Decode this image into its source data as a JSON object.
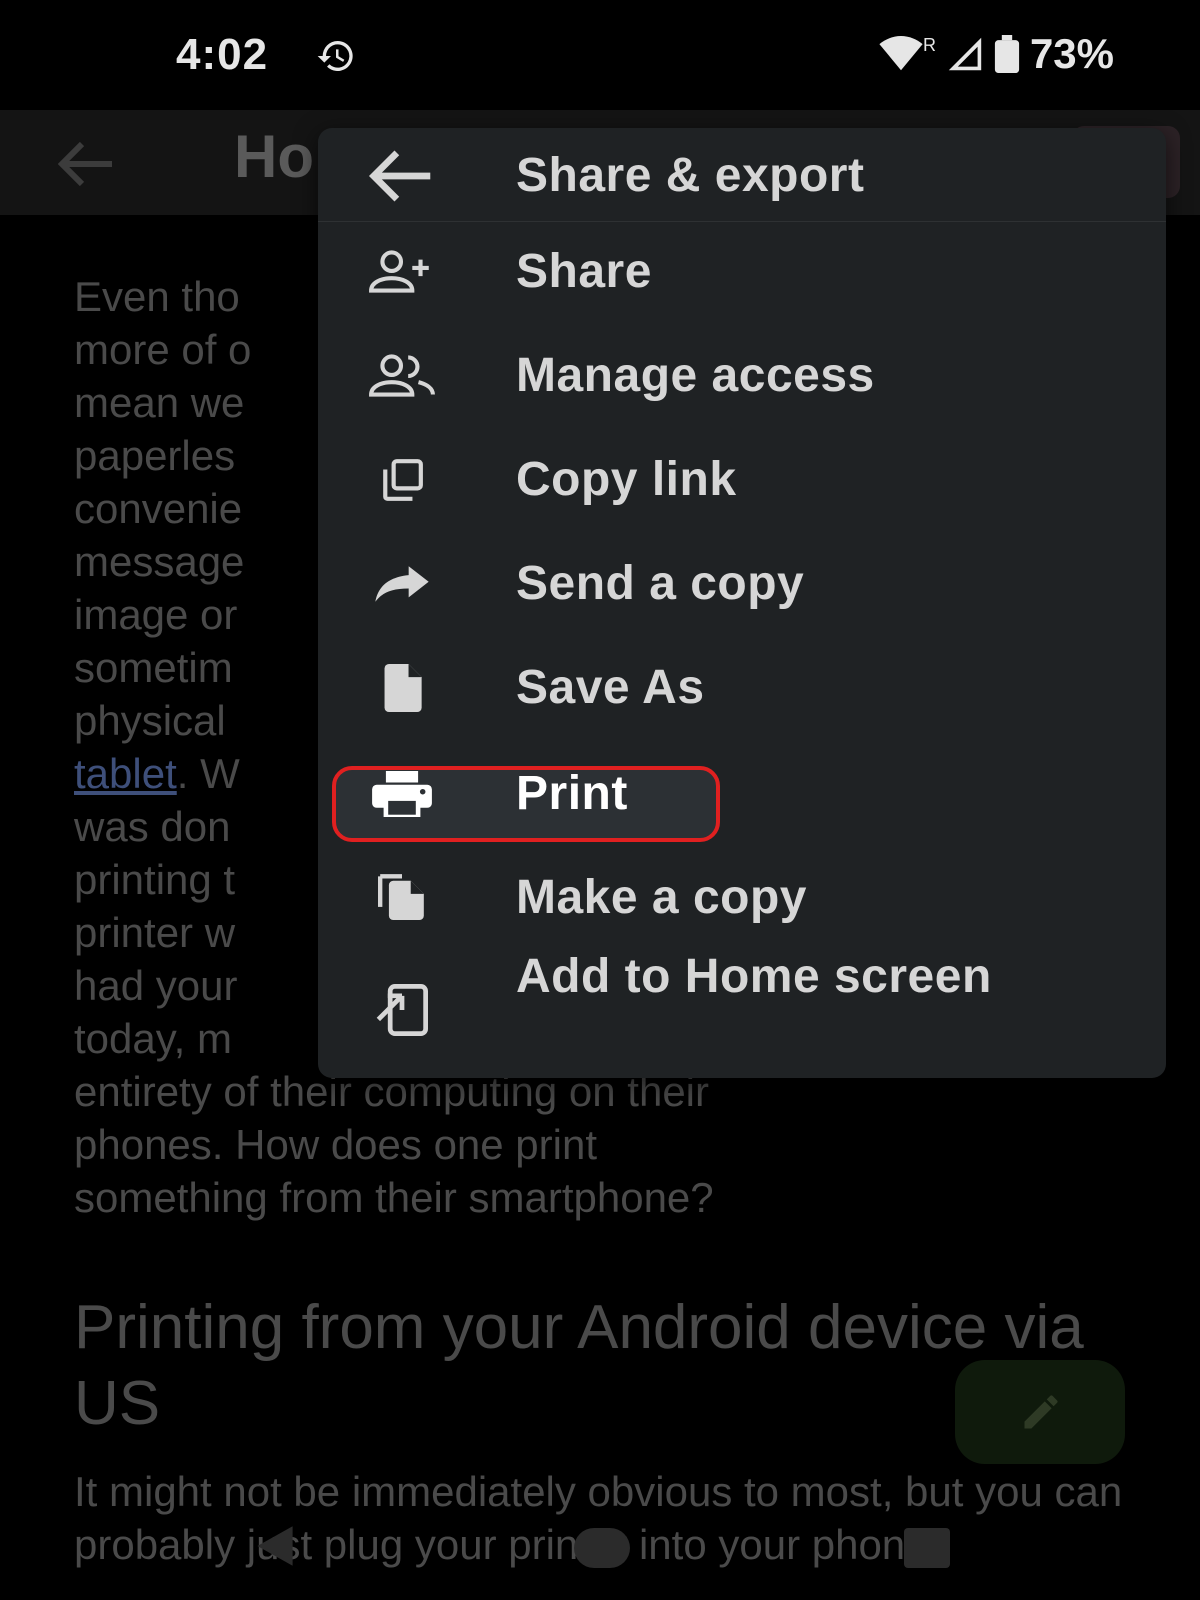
{
  "status_bar": {
    "time": "4:02",
    "battery": "73%",
    "network_badge": "R"
  },
  "app_bar": {
    "title_partial": "Ho"
  },
  "document": {
    "paragraph1": [
      {
        "text": "Even tho"
      },
      {
        "text": "more of o"
      },
      {
        "text": "mean we"
      },
      {
        "text": "paperles"
      },
      {
        "text": "convenie"
      },
      {
        "text": "message"
      },
      {
        "text": "image or"
      },
      {
        "text": "sometim"
      },
      {
        "text": "physical"
      },
      {
        "text": "tablet",
        "link": true,
        "suffix": ". W"
      },
      {
        "text": "was don"
      },
      {
        "text": "printing t"
      },
      {
        "text": "printer w"
      },
      {
        "text": "had your"
      },
      {
        "text": "today, m"
      },
      {
        "text": "entirety of their computing on their"
      },
      {
        "text": "phones. How does one print"
      },
      {
        "text": "something from their smartphone?"
      }
    ],
    "heading": "Printing from your Android device via US",
    "paragraph2": "It might not be immediately obvious to most, but you can probably just plug your printer into your phone"
  },
  "menu": {
    "header": "Share & export",
    "items": [
      {
        "id": "share",
        "label": "Share",
        "icon": "person-add-icon"
      },
      {
        "id": "manage",
        "label": "Manage access",
        "icon": "people-icon"
      },
      {
        "id": "copy-link",
        "label": "Copy link",
        "icon": "copy-icon"
      },
      {
        "id": "send-copy",
        "label": "Send a copy",
        "icon": "forward-arrow-icon"
      },
      {
        "id": "save-as",
        "label": "Save As",
        "icon": "file-icon"
      },
      {
        "id": "print",
        "label": "Print",
        "icon": "printer-icon",
        "highlighted": true
      },
      {
        "id": "make-copy",
        "label": "Make a copy",
        "icon": "file-copy-icon"
      },
      {
        "id": "home-screen",
        "label": "Add to Home screen",
        "icon": "add-to-home-icon"
      }
    ]
  },
  "colors": {
    "highlight_border": "#e02020",
    "menu_background": "#1f2224",
    "text": "#d6d6d6"
  }
}
